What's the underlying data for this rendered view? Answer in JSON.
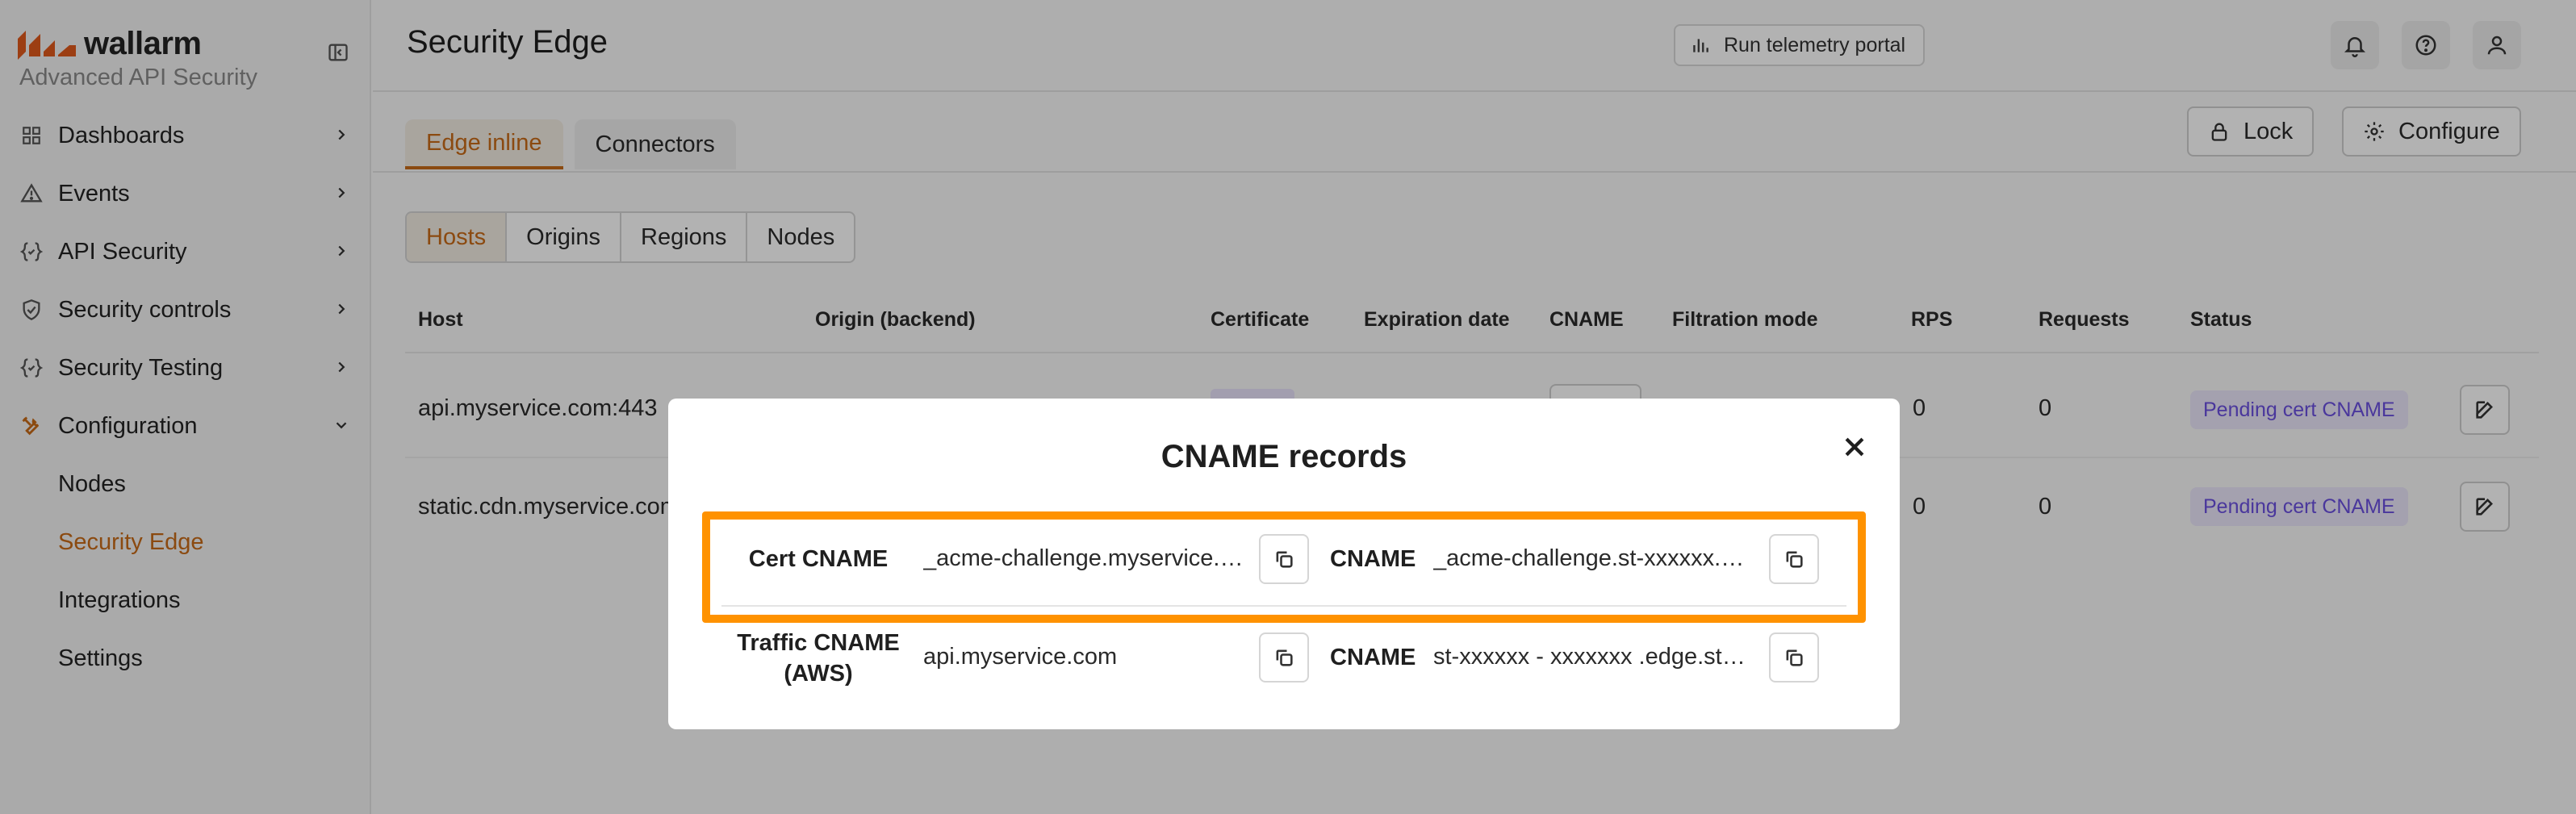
{
  "brand": {
    "name": "wallarm",
    "subtitle": "Advanced API Security",
    "accent": "#c86a17"
  },
  "sidebar": {
    "items": [
      {
        "label": "Dashboards",
        "icon": "grid-icon"
      },
      {
        "label": "Events",
        "icon": "warning-icon"
      },
      {
        "label": "API Security",
        "icon": "braces-icon"
      },
      {
        "label": "Security controls",
        "icon": "shield-icon"
      },
      {
        "label": "Security Testing",
        "icon": "braces-icon"
      },
      {
        "label": "Configuration",
        "icon": "tools-icon",
        "expanded": true
      }
    ],
    "subitems": [
      {
        "label": "Nodes"
      },
      {
        "label": "Security Edge",
        "active": true
      },
      {
        "label": "Integrations"
      },
      {
        "label": "Settings"
      }
    ]
  },
  "header": {
    "title": "Security Edge",
    "telemetry_label": "Run telemetry portal"
  },
  "tabs": [
    {
      "label": "Edge inline",
      "active": true
    },
    {
      "label": "Connectors"
    }
  ],
  "actions": {
    "lock_label": "Lock",
    "configure_label": "Configure"
  },
  "segments": [
    {
      "label": "Hosts",
      "active": true
    },
    {
      "label": "Origins"
    },
    {
      "label": "Regions"
    },
    {
      "label": "Nodes"
    }
  ],
  "table": {
    "columns": [
      "Host",
      "Origin (backend)",
      "Certificate",
      "Expiration date",
      "CNAME",
      "Filtration mode",
      "RPS",
      "Requests",
      "Status"
    ],
    "rows": [
      {
        "host": "api.myservice.com:443",
        "rps": "0",
        "requests": "0",
        "status": "Pending cert CNAME"
      },
      {
        "host": "static.cdn.myservice.com",
        "rps": "0",
        "requests": "0",
        "status": "Pending cert CNAME"
      }
    ]
  },
  "modal": {
    "title": "CNAME records",
    "rows": [
      {
        "label": "Cert CNAME",
        "value": "_acme-challenge.myservice.com",
        "cname_label": "CNAME",
        "cname_value": "_acme-challenge.st-xxxxxx.edge.st.wallarm.com",
        "highlighted": true
      },
      {
        "label": "Traffic CNAME (AWS)",
        "value": "api.myservice.com",
        "cname_label": "CNAME",
        "cname_value": "st-xxxxxx - xxxxxxx .edge.st.wallarm.com",
        "highlighted": false
      }
    ],
    "highlight_color": "#ff9200"
  }
}
